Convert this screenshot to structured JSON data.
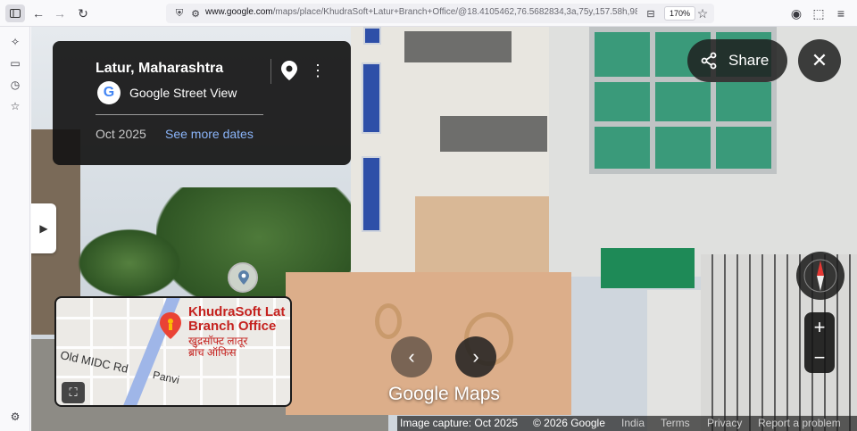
{
  "browser": {
    "url_domain": "www.google.com",
    "url_path": "/maps/place/KhudraSoft+Latur+Branch+Office/@18.4105462,76.5682834,3a,75y,157.58h,98.1t/d",
    "zoom": "170%"
  },
  "panel": {
    "title": "Latur, Maharashtra",
    "subtitle": "Google Street View",
    "date": "Oct 2025",
    "see_more": "See more dates",
    "more_glyph": "⋮"
  },
  "controls": {
    "share_label": "Share",
    "close_glyph": "✕",
    "expand_glyph": "▶",
    "back_glyph": "‹",
    "forward_glyph": "›",
    "zoom_in": "+",
    "zoom_out": "−"
  },
  "minimap": {
    "place_name_line1": "KhudraSoft Lat",
    "place_name_line2": "Branch Office",
    "place_name_hindi_line1": "खुद्रसॉफ्ट लातूर",
    "place_name_hindi_line2": "ब्रांच ऑफिस",
    "road1": "Old MIDC Rd",
    "road2": "Panvi",
    "fullscreen_glyph": "⛶"
  },
  "watermark": "Google Maps",
  "footer": {
    "capture": "Image capture: Oct 2025",
    "copyright": "© 2026 Google",
    "country": "India",
    "terms": "Terms",
    "privacy": "Privacy",
    "report": "Report a problem"
  },
  "colors": {
    "link": "#8ab4f8",
    "place_red": "#c5221f",
    "road_blue": "#9fb6e8"
  },
  "icons": [
    "sidebar-icon",
    "back-icon",
    "forward-icon",
    "reload-icon",
    "shield-icon",
    "page-info-icon",
    "reader-icon",
    "star-icon",
    "account-icon",
    "extensions-icon",
    "menu-icon",
    "ai-chat-icon",
    "synced-tabs-icon",
    "history-icon",
    "bookmarks-icon",
    "settings-icon",
    "pin-icon",
    "share-icon",
    "google-icon",
    "compass-icon",
    "pegman-icon"
  ]
}
